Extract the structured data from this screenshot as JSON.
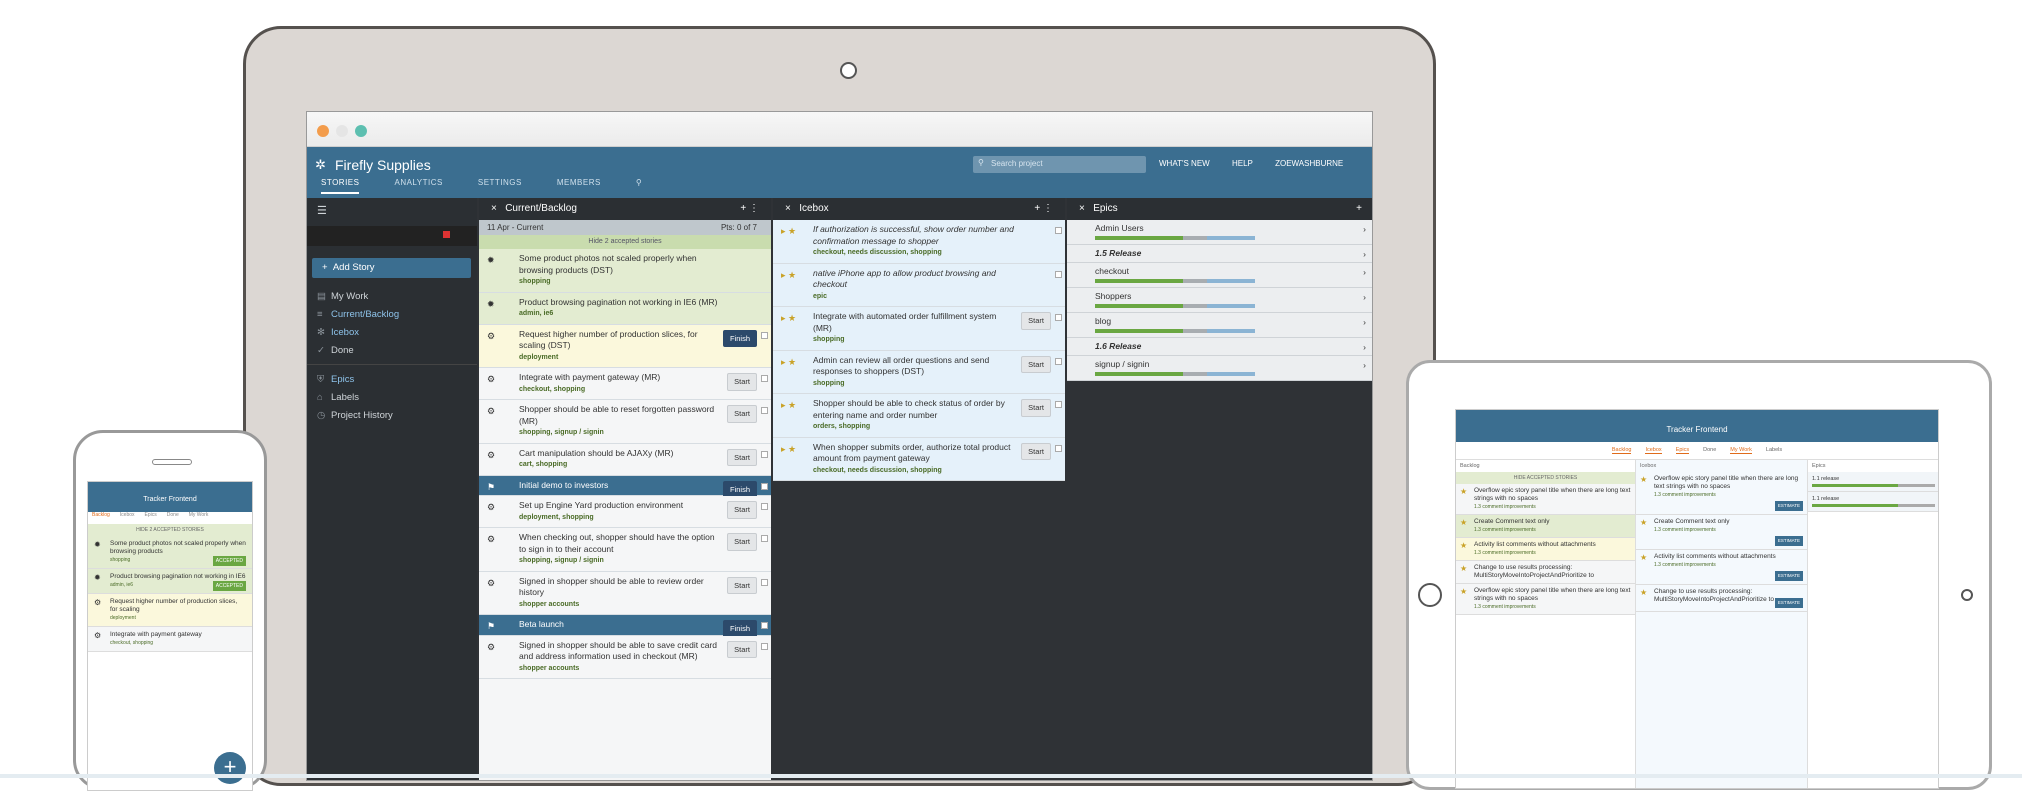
{
  "laptop": {
    "project_name": "Firefly Supplies",
    "tabs": [
      "STORIES",
      "ANALYTICS",
      "SETTINGS",
      "MEMBERS"
    ],
    "search_placeholder": "Search project",
    "nav": [
      "WHAT'S NEW",
      "HELP",
      "ZOEWASHBURNE"
    ],
    "sidebar": {
      "add_story": "Add Story",
      "items": [
        "My Work",
        "Current/Backlog",
        "Icebox",
        "Done",
        "Epics",
        "Labels",
        "Project History"
      ]
    },
    "backlog": {
      "title": "Current/Backlog",
      "iteration": "11 Apr - Current",
      "points": "Pts: 0 of 7",
      "hide_accepted": "Hide 2 accepted stories",
      "stories": [
        {
          "title": "Some product photos not scaled properly when browsing products (DST)",
          "labels": "shopping",
          "state": "accepted",
          "button": ""
        },
        {
          "title": "Product browsing pagination not working in IE6 (MR)",
          "labels": "admin, ie6",
          "state": "accepted",
          "button": ""
        },
        {
          "title": "Request higher number of production slices, for scaling (DST)",
          "labels": "deployment",
          "state": "started",
          "button": "Finish"
        },
        {
          "title": "Integrate with payment gateway (MR)",
          "labels": "checkout, shopping",
          "state": "unstarted",
          "button": "Start"
        },
        {
          "title": "Shopper should be able to reset forgotten password (MR)",
          "labels": "shopping, signup / signin",
          "state": "unstarted",
          "button": "Start"
        },
        {
          "title": "Cart manipulation should be AJAXy (MR)",
          "labels": "cart, shopping",
          "state": "unstarted",
          "button": "Start"
        },
        {
          "title": "Initial demo to investors",
          "labels": "",
          "state": "release",
          "button": "Finish"
        },
        {
          "title": "Set up Engine Yard production environment",
          "labels": "deployment, shopping",
          "state": "unstarted",
          "button": "Start"
        },
        {
          "title": "When checking out, shopper should have the option to sign in to their account",
          "labels": "shopping, signup / signin",
          "state": "unstarted",
          "button": "Start"
        },
        {
          "title": "Signed in shopper should be able to review order history",
          "labels": "shopper accounts",
          "state": "unstarted",
          "button": "Start"
        },
        {
          "title": "Beta launch",
          "labels": "",
          "state": "release",
          "button": "Finish"
        },
        {
          "title": "Signed in shopper should be able to save credit card and address information used in checkout (MR)",
          "labels": "shopper accounts",
          "state": "unstarted",
          "button": "Start"
        }
      ]
    },
    "icebox": {
      "title": "Icebox",
      "stories": [
        {
          "title": "If authorization is successful, show order number and confirmation message to shopper",
          "labels": "checkout, needs discussion, shopping",
          "button": ""
        },
        {
          "title": "native iPhone app to allow product browsing and checkout",
          "labels": "epic",
          "button": ""
        },
        {
          "title": "Integrate with automated order fulfillment system (MR)",
          "labels": "shopping",
          "button": "Start"
        },
        {
          "title": "Admin can review all order questions and send responses to shoppers (DST)",
          "labels": "shopping",
          "button": "Start"
        },
        {
          "title": "Shopper should be able to check status of order by entering name and order number",
          "labels": "orders, shopping",
          "button": "Start"
        },
        {
          "title": "When shopper submits order, authorize total product amount from payment gateway",
          "labels": "checkout, needs discussion, shopping",
          "button": "Start"
        }
      ]
    },
    "epics": {
      "title": "Epics",
      "items": [
        "Admin Users",
        "1.5 Release",
        "checkout",
        "Shoppers",
        "blog",
        "1.6 Release",
        "signup / signin"
      ]
    }
  },
  "phone": {
    "title": "Tracker Frontend",
    "tabs": [
      "Backlog",
      "Icebox",
      "Epics",
      "Done",
      "My Work"
    ],
    "hide_accepted": "HIDE 2 ACCEPTED STORIES",
    "stories": [
      {
        "title": "Some product photos not scaled properly when browsing products",
        "labels": "shopping",
        "badge": "ACCEPTED"
      },
      {
        "title": "Product browsing pagination not working in IE6",
        "labels": "admin, ie6",
        "badge": "ACCEPTED"
      },
      {
        "title": "Request higher number of production slices, for scaling",
        "labels": "deployment",
        "badge": ""
      },
      {
        "title": "Integrate with payment gateway",
        "labels": "checkout, shopping",
        "badge": ""
      }
    ]
  },
  "tablet": {
    "title": "Tracker Frontend",
    "tabs": [
      "Backlog",
      "Icebox",
      "Epics",
      "Done",
      "My Work",
      "Labels"
    ],
    "backlog_title": "Backlog",
    "icebox_title": "Icebox",
    "epics_title": "Epics",
    "hide_accepted": "HIDE ACCEPTED STORIES",
    "backlog": [
      {
        "title": "Overflow epic story panel title when there are long text strings with no spaces",
        "labels": "1.3 comment improvements"
      },
      {
        "title": "Create Comment text only",
        "labels": "1.3 comment improvements"
      },
      {
        "title": "Activity list comments without attachments",
        "labels": "1.3 comment improvements"
      },
      {
        "title": "Change to use results processing: MultiStoryMoveIntoProjectAndPrioritize to",
        "labels": ""
      },
      {
        "title": "Overflow epic story panel title when there are long text strings with no spaces",
        "labels": "1.3 comment improvements"
      }
    ],
    "icebox": [
      {
        "title": "Overflow epic story panel title when there are long text strings with no spaces",
        "labels": "1.3 comment improvements",
        "chip": "ESTIMATE"
      },
      {
        "title": "Create Comment text only",
        "labels": "1.3 comment improvements",
        "chip": "ESTIMATE"
      },
      {
        "title": "Activity list comments without attachments",
        "labels": "1.3 comment improvements",
        "chip": "ESTIMATE"
      },
      {
        "title": "Change to use results processing: MultiStoryMoveIntoProjectAndPrioritize to",
        "labels": "",
        "chip": "ESTIMATE"
      }
    ],
    "epics": [
      "1.1 release",
      "1.1 release"
    ]
  }
}
